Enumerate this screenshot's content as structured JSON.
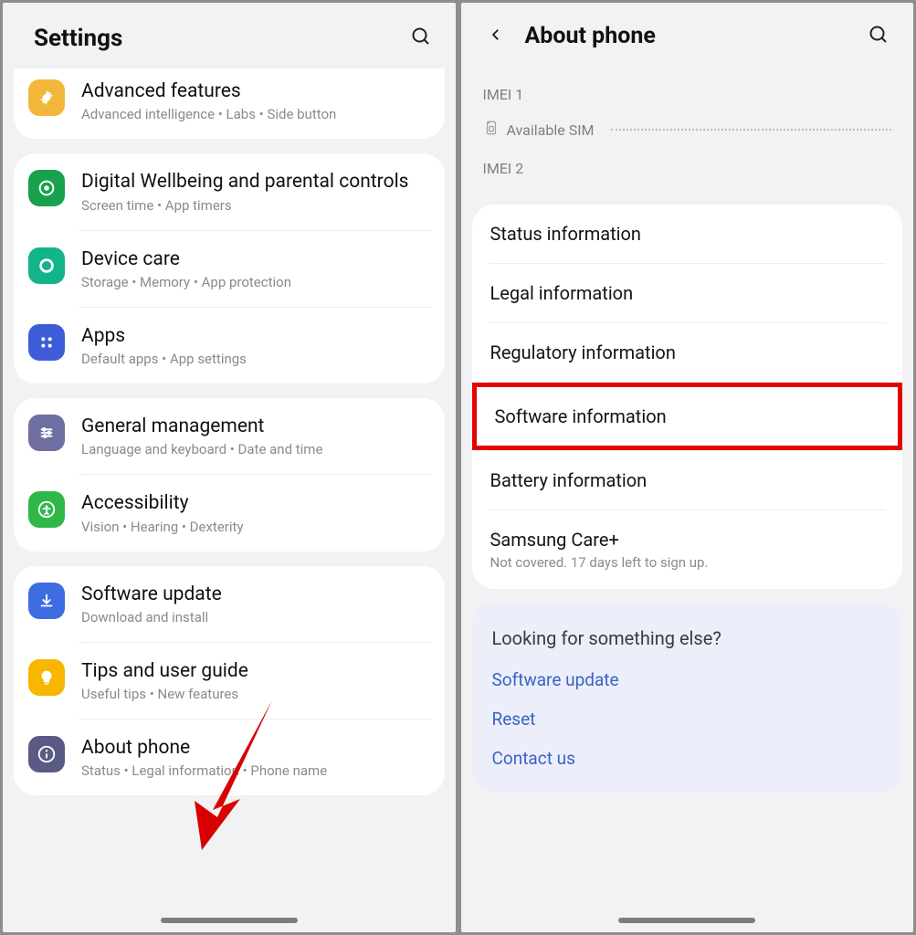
{
  "left": {
    "title": "Settings",
    "groups": [
      {
        "items": [
          {
            "id": "advanced-features",
            "title": "Advanced features",
            "sub": "Advanced intelligence  •  Labs  •  Side button",
            "icon": "gear-badge-icon",
            "color": "#f2b63a"
          }
        ],
        "clippedTop": true
      },
      {
        "items": [
          {
            "id": "digital-wellbeing",
            "title": "Digital Wellbeing and parental controls",
            "sub": "Screen time  •  App timers",
            "icon": "target-icon",
            "color": "#18a24d"
          },
          {
            "id": "device-care",
            "title": "Device care",
            "sub": "Storage  •  Memory  •  App protection",
            "icon": "ring-icon",
            "color": "#12b489"
          },
          {
            "id": "apps",
            "title": "Apps",
            "sub": "Default apps  •  App settings",
            "icon": "grid-dots-icon",
            "color": "#3f5cd8"
          }
        ]
      },
      {
        "items": [
          {
            "id": "general-management",
            "title": "General management",
            "sub": "Language and keyboard  •  Date and time",
            "icon": "sliders-icon",
            "color": "#6e6ea0"
          },
          {
            "id": "accessibility",
            "title": "Accessibility",
            "sub": "Vision  •  Hearing  •  Dexterity",
            "icon": "person-circle-icon",
            "color": "#2fb74a"
          }
        ]
      },
      {
        "items": [
          {
            "id": "software-update",
            "title": "Software update",
            "sub": "Download and install",
            "icon": "download-icon",
            "color": "#3d6de0"
          },
          {
            "id": "tips",
            "title": "Tips and user guide",
            "sub": "Useful tips  •  New features",
            "icon": "bulb-icon",
            "color": "#f8b600"
          },
          {
            "id": "about-phone",
            "title": "About phone",
            "sub": "Status  •  Legal information  •  Phone name",
            "icon": "info-icon",
            "color": "#5a5a86"
          }
        ]
      }
    ]
  },
  "right": {
    "title": "About phone",
    "imei1": "IMEI 1",
    "sim_label": "Available SIM",
    "imei2": "IMEI 2",
    "info_rows": [
      {
        "id": "status-info",
        "title": "Status information"
      },
      {
        "id": "legal-info",
        "title": "Legal information"
      },
      {
        "id": "regulatory-info",
        "title": "Regulatory information"
      },
      {
        "id": "software-info",
        "title": "Software information",
        "highlight": true
      },
      {
        "id": "battery-info",
        "title": "Battery information"
      },
      {
        "id": "samsung-care",
        "title": "Samsung Care+",
        "sub": "Not covered. 17 days left to sign up."
      }
    ],
    "suggest_title": "Looking for something else?",
    "suggest_links": [
      {
        "id": "link-software-update",
        "label": "Software update"
      },
      {
        "id": "link-reset",
        "label": "Reset"
      },
      {
        "id": "link-contact",
        "label": "Contact us"
      }
    ]
  }
}
